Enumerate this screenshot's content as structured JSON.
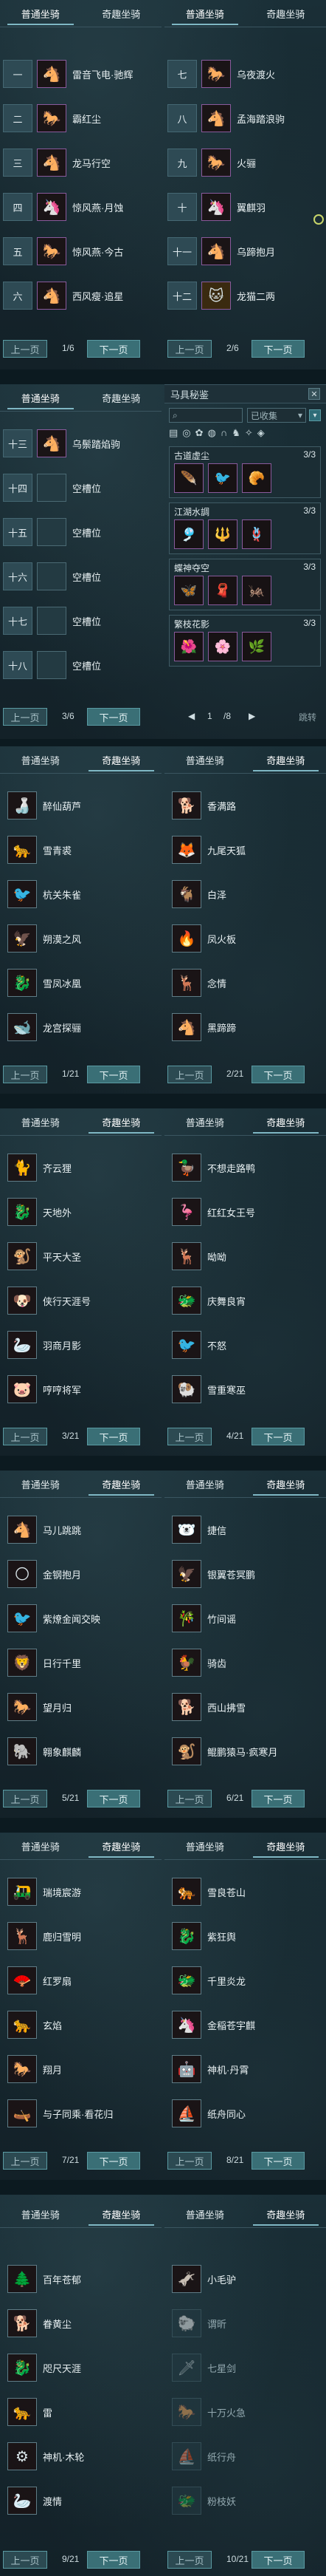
{
  "tabs": {
    "left": "普通坐骑",
    "right": "奇趣坐骑"
  },
  "buttons": {
    "prev": "上一页",
    "next": "下一页"
  },
  "panel1": {
    "left": {
      "rows": [
        [
          "一",
          "雷音飞电·驰辉"
        ],
        [
          "二",
          "霸红尘"
        ],
        [
          "三",
          "龙马行空"
        ],
        [
          "四",
          "惊风燕·月蚀"
        ],
        [
          "五",
          "惊风燕·今古"
        ],
        [
          "六",
          "西风瘦·追星"
        ]
      ],
      "page": "1/6"
    },
    "right": {
      "rows": [
        [
          "七",
          "乌夜渡火"
        ],
        [
          "八",
          "孟海踏浪驹"
        ],
        [
          "九",
          "火骊"
        ],
        [
          "十",
          "翼麒羽"
        ],
        [
          "十一",
          "乌蹄抱月"
        ],
        [
          "十二",
          "龙猫二两"
        ]
      ],
      "page": "2/6"
    }
  },
  "panel2": {
    "left": {
      "rows": [
        [
          "十三",
          "乌鬃踏焰驹"
        ],
        [
          "十四",
          "空槽位"
        ],
        [
          "十五",
          "空槽位"
        ],
        [
          "十六",
          "空槽位"
        ],
        [
          "十七",
          "空槽位"
        ],
        [
          "十八",
          "空槽位"
        ]
      ],
      "page": "3/6"
    },
    "right": {
      "title": "马具秘鉴",
      "search_placeholder": "",
      "filter": "已收集",
      "groups": [
        {
          "name": "古道虚尘",
          "count": "3/3"
        },
        {
          "name": "江湖水調",
          "count": "3/3"
        },
        {
          "name": "蝶神夺空",
          "count": "3/3"
        },
        {
          "name": "繁枝花影",
          "count": "3/3"
        }
      ],
      "page_current": "1",
      "page_total": "/8",
      "jump": "跳转"
    }
  },
  "panel3": {
    "left": {
      "rows": [
        "醉仙葫芦",
        "雪青裘",
        "杭关朱雀",
        "朔漠之风",
        "雪凤冰凰",
        "龙宫探骊"
      ],
      "page": "1/21"
    },
    "right": {
      "rows": [
        "香满路",
        "九尾天狐",
        "白泽",
        "凤火板",
        "念情",
        "黑蹄蹄"
      ],
      "page": "2/21"
    }
  },
  "panel4": {
    "left": {
      "rows": [
        "齐云狸",
        "天地外",
        "平天大圣",
        "侠行天涯号",
        "羽商月影",
        "哼哼将军"
      ],
      "page": "3/21"
    },
    "right": {
      "rows": [
        "不想走路鸭",
        "红红女王号",
        "呦呦",
        "庆舞良宵",
        "不怒",
        "雪重寒巫"
      ],
      "page": "4/21"
    }
  },
  "panel5": {
    "left": {
      "rows": [
        "马儿跳跳",
        "金钢抱月",
        "紫燎金闻交映",
        "日行千里",
        "望月归",
        "翱象麒麟"
      ],
      "page": "5/21"
    },
    "right": {
      "rows": [
        "捷信",
        "银翼苍冥鹏",
        "竹间谣",
        "骑齿",
        "西山拂雪",
        "鲲鹏猿马·疯寒月"
      ],
      "page": "6/21"
    }
  },
  "panel6": {
    "left": {
      "rows": [
        "瑞境宸游",
        "鹿归雪明",
        "红罗扇",
        "玄焰",
        "翔月",
        "与子同乘·看花归"
      ],
      "page": "7/21"
    },
    "right": {
      "rows": [
        "雪良苍山",
        "紫狂舆",
        "千里炎龙",
        "金稲苍宇麒",
        "神机·丹霄",
        "纸舟同心"
      ],
      "page": "8/21"
    }
  },
  "panel7": {
    "left": {
      "rows": [
        "百年苍郁",
        "眷黄尘",
        "咫尺天涯",
        "雷",
        "神机·木轮",
        "渡情"
      ],
      "page": "9/21"
    },
    "right": {
      "rows": [
        "小毛驴",
        "谓昕",
        "七星剑",
        "十万火急",
        "纸行舟",
        "粉枝妖"
      ],
      "dim_from": 1,
      "page": "10/21"
    }
  }
}
